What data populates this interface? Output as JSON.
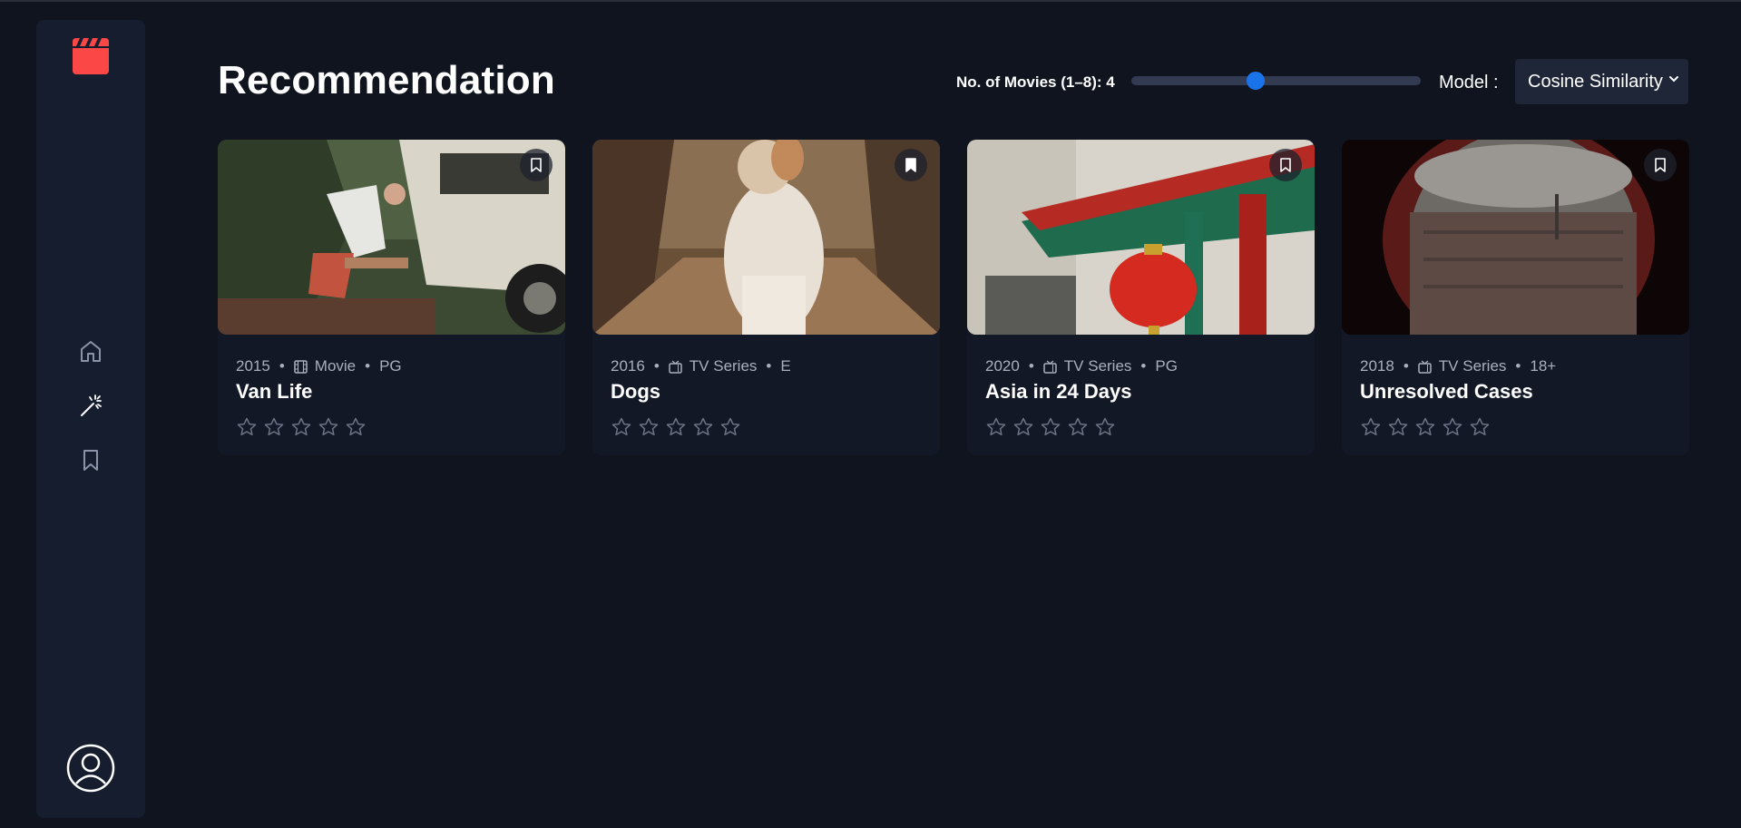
{
  "app": {
    "colors": {
      "background": "#10141e",
      "sidebar": "#161d2f",
      "accent": "#fc4747",
      "slider": "#1a73e8"
    }
  },
  "sidebar": {
    "logo": "clapperboard-icon",
    "items": [
      {
        "name": "home",
        "icon": "home-icon"
      },
      {
        "name": "recommendation",
        "icon": "magic-wand-icon"
      },
      {
        "name": "bookmarks",
        "icon": "bookmark-icon"
      }
    ],
    "avatar": "user-avatar-icon"
  },
  "header": {
    "title": "Recommendation",
    "movies_label": "No. of Movies (1–8): 4",
    "movies_count": 4,
    "movies_min": 1,
    "movies_max": 8,
    "model_label": "Model :",
    "model_value": "Cosine Similarity"
  },
  "cards": [
    {
      "year": "2015",
      "type": "Movie",
      "type_icon": "film-icon",
      "rating": "PG",
      "title": "Van Life",
      "bookmarked": false,
      "stars": 0
    },
    {
      "year": "2016",
      "type": "TV Series",
      "type_icon": "tv-icon",
      "rating": "E",
      "title": "Dogs",
      "bookmarked": true,
      "stars": 0
    },
    {
      "year": "2020",
      "type": "TV Series",
      "type_icon": "tv-icon",
      "rating": "PG",
      "title": "Asia in 24 Days",
      "bookmarked": false,
      "stars": 0
    },
    {
      "year": "2018",
      "type": "TV Series",
      "type_icon": "tv-icon",
      "rating": "18+",
      "title": "Unresolved Cases",
      "bookmarked": false,
      "stars": 0
    }
  ]
}
